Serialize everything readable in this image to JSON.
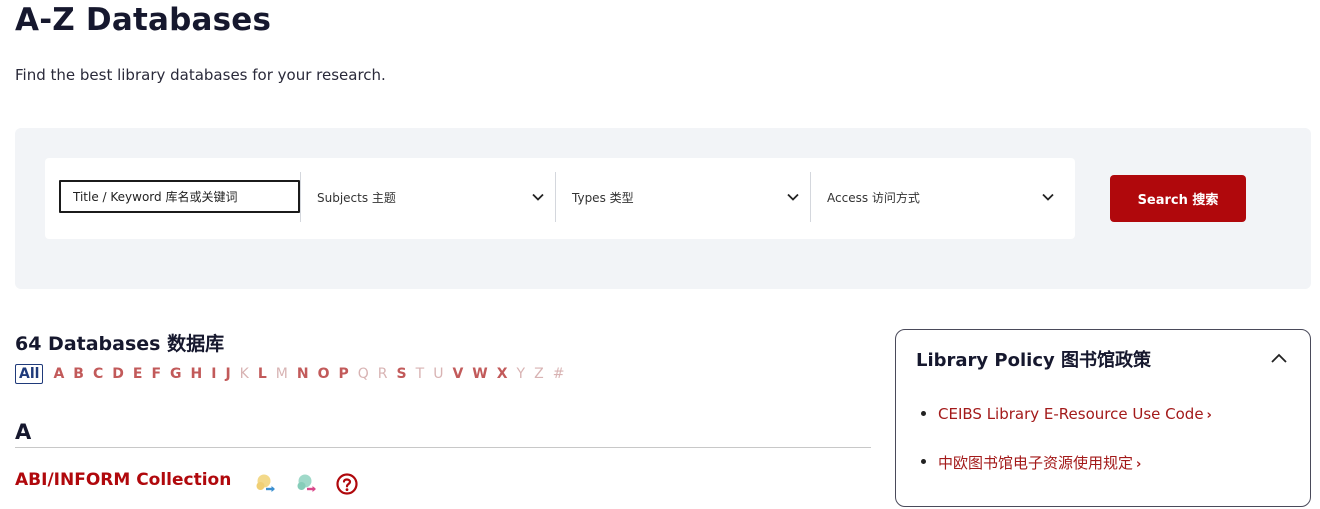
{
  "page": {
    "title": "A-Z Databases",
    "subtitle": "Find the best library databases for your research."
  },
  "search": {
    "keyword_placeholder": "Title / Keyword 库名或关键词",
    "subjects_label": "Subjects 主题",
    "types_label": "Types 类型",
    "access_label": "Access 访问方式",
    "button_label": "Search 搜索",
    "accent_color": "#b0080c"
  },
  "results": {
    "count_heading": "64 Databases 数据库",
    "letters": [
      {
        "label": "All",
        "state": "active"
      },
      {
        "label": "A",
        "state": "enabled"
      },
      {
        "label": "B",
        "state": "enabled"
      },
      {
        "label": "C",
        "state": "enabled"
      },
      {
        "label": "D",
        "state": "enabled"
      },
      {
        "label": "E",
        "state": "enabled"
      },
      {
        "label": "F",
        "state": "enabled"
      },
      {
        "label": "G",
        "state": "enabled"
      },
      {
        "label": "H",
        "state": "enabled"
      },
      {
        "label": "I",
        "state": "enabled"
      },
      {
        "label": "J",
        "state": "enabled"
      },
      {
        "label": "K",
        "state": "disabled"
      },
      {
        "label": "L",
        "state": "enabled"
      },
      {
        "label": "M",
        "state": "disabled"
      },
      {
        "label": "N",
        "state": "enabled"
      },
      {
        "label": "O",
        "state": "enabled"
      },
      {
        "label": "P",
        "state": "enabled"
      },
      {
        "label": "Q",
        "state": "disabled"
      },
      {
        "label": "R",
        "state": "disabled"
      },
      {
        "label": "S",
        "state": "enabled"
      },
      {
        "label": "T",
        "state": "disabled"
      },
      {
        "label": "U",
        "state": "disabled"
      },
      {
        "label": "V",
        "state": "enabled"
      },
      {
        "label": "W",
        "state": "enabled"
      },
      {
        "label": "X",
        "state": "enabled"
      },
      {
        "label": "Y",
        "state": "disabled"
      },
      {
        "label": "Z",
        "state": "disabled"
      },
      {
        "label": "#",
        "state": "disabled"
      }
    ],
    "section_letter": "A",
    "databases": [
      {
        "name": "ABI/INFORM Collection",
        "icons": [
          "access-icon-yellow",
          "access-icon-teal",
          "help-circle-icon"
        ]
      }
    ]
  },
  "policy": {
    "title": "Library Policy 图书馆政策",
    "items": [
      {
        "label": "CEIBS Library E-Resource Use Code",
        "arrow": "›"
      },
      {
        "label": "中欧图书馆电子资源使用规定",
        "arrow": "›"
      }
    ]
  }
}
